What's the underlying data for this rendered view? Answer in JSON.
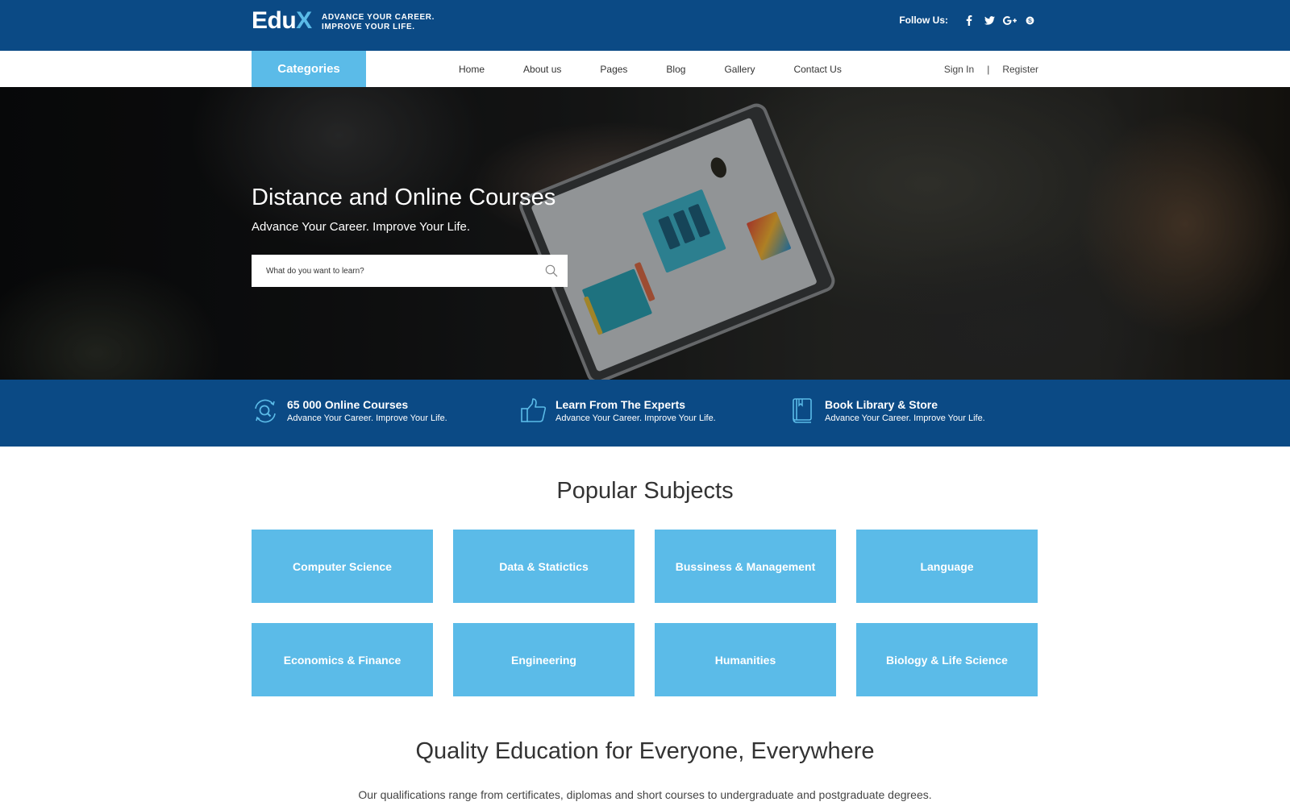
{
  "brand": {
    "logo_main": "Edu",
    "logo_accent": "X",
    "tagline_line1": "ADVANCE YOUR CAREER.",
    "tagline_line2": "IMPROVE YOUR LIFE."
  },
  "social": {
    "label": "Follow Us:",
    "icons": [
      "facebook-icon",
      "twitter-icon",
      "google-plus-icon",
      "skype-icon"
    ]
  },
  "nav": {
    "categories_label": "Categories",
    "links": [
      "Home",
      "About us",
      "Pages",
      "Blog",
      "Gallery",
      "Contact Us"
    ],
    "sign_in": "Sign In",
    "separator": "|",
    "register": "Register"
  },
  "hero": {
    "title": "Distance and Online Courses",
    "subtitle": "Advance Your Career. Improve Your Life.",
    "search_placeholder": "What do you want to learn?",
    "search_value": ""
  },
  "features": [
    {
      "icon": "search-refresh-icon",
      "title": "65 000 Online Courses",
      "subtitle": "Advance Your Career. Improve Your Life."
    },
    {
      "icon": "thumbs-up-icon",
      "title": "Learn From The Experts",
      "subtitle": "Advance Your Career. Improve Your Life."
    },
    {
      "icon": "book-icon",
      "title": "Book Library & Store",
      "subtitle": "Advance Your Career. Improve Your Life."
    }
  ],
  "popular": {
    "title": "Popular Subjects",
    "subjects": [
      "Computer Science",
      "Data & Statictics",
      "Bussiness & Management",
      "Language",
      "Economics & Finance",
      "Engineering",
      "Humanities",
      "Biology & Life Science"
    ]
  },
  "quality": {
    "title": "Quality Education for Everyone, Everywhere",
    "description": "Our qualifications range from certificates, diplomas and short courses to undergraduate and postgraduate degrees."
  },
  "colors": {
    "primary_dark": "#0b4a85",
    "accent_light": "#5bbbe8"
  }
}
